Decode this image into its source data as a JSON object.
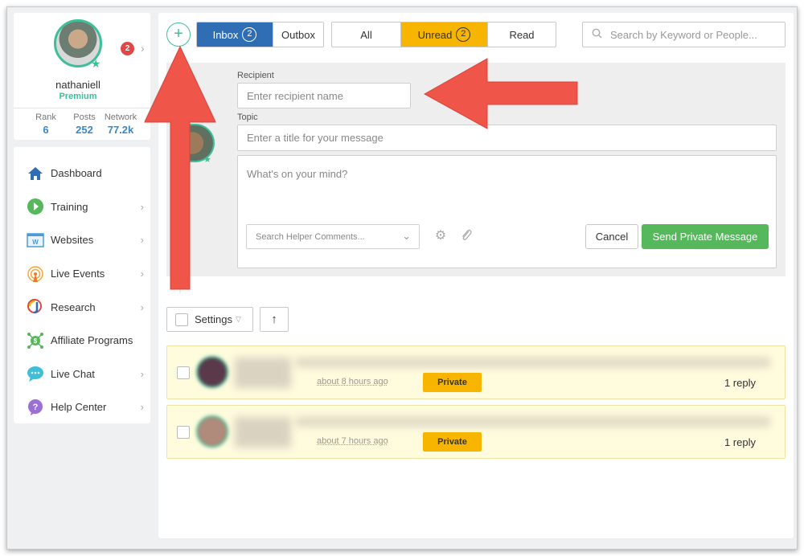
{
  "profile": {
    "username": "nathaniell",
    "tier": "Premium",
    "notifications": "2",
    "stats": [
      {
        "label": "Rank",
        "value": "6"
      },
      {
        "label": "Posts",
        "value": "252"
      },
      {
        "label": "Network",
        "value": "77.2k"
      }
    ]
  },
  "nav": {
    "items": [
      {
        "label": "Dashboard",
        "icon": "home-icon"
      },
      {
        "label": "Training",
        "icon": "play-icon"
      },
      {
        "label": "Websites",
        "icon": "website-icon"
      },
      {
        "label": "Live Events",
        "icon": "broadcast-icon"
      },
      {
        "label": "Research",
        "icon": "research-icon"
      },
      {
        "label": "Affiliate Programs",
        "icon": "affiliate-icon"
      },
      {
        "label": "Live Chat",
        "icon": "chat-icon"
      },
      {
        "label": "Help Center",
        "icon": "help-icon"
      }
    ]
  },
  "toolbar": {
    "compose_symbol": "+",
    "box_tabs": [
      {
        "label": "Inbox",
        "count": "2"
      },
      {
        "label": "Outbox"
      }
    ],
    "filter_tabs": [
      {
        "label": "All"
      },
      {
        "label": "Unread",
        "count": "2"
      },
      {
        "label": "Read"
      }
    ],
    "search_placeholder": "Search by Keyword or People..."
  },
  "compose": {
    "recipient_label": "Recipient",
    "recipient_placeholder": "Enter recipient name",
    "topic_label": "Topic",
    "topic_placeholder": "Enter a title for your message",
    "body_placeholder": "What's on your mind?",
    "helper_placeholder": "Search Helper Comments...",
    "cancel_label": "Cancel",
    "send_label": "Send Private Message"
  },
  "list_controls": {
    "settings_label": "Settings",
    "sort_symbol": "↑"
  },
  "messages": [
    {
      "time": "about 8 hours ago",
      "badge": "Private",
      "replies": "1 reply"
    },
    {
      "time": "about 7 hours ago",
      "badge": "Private",
      "replies": "1 reply"
    }
  ],
  "colors": {
    "accent_teal": "#3dbf9a",
    "inbox_blue": "#2f6db5",
    "unread_yellow": "#f7b500",
    "send_green": "#55b95c",
    "annotation_red": "#f0554a",
    "message_bg": "#fffbdd"
  }
}
